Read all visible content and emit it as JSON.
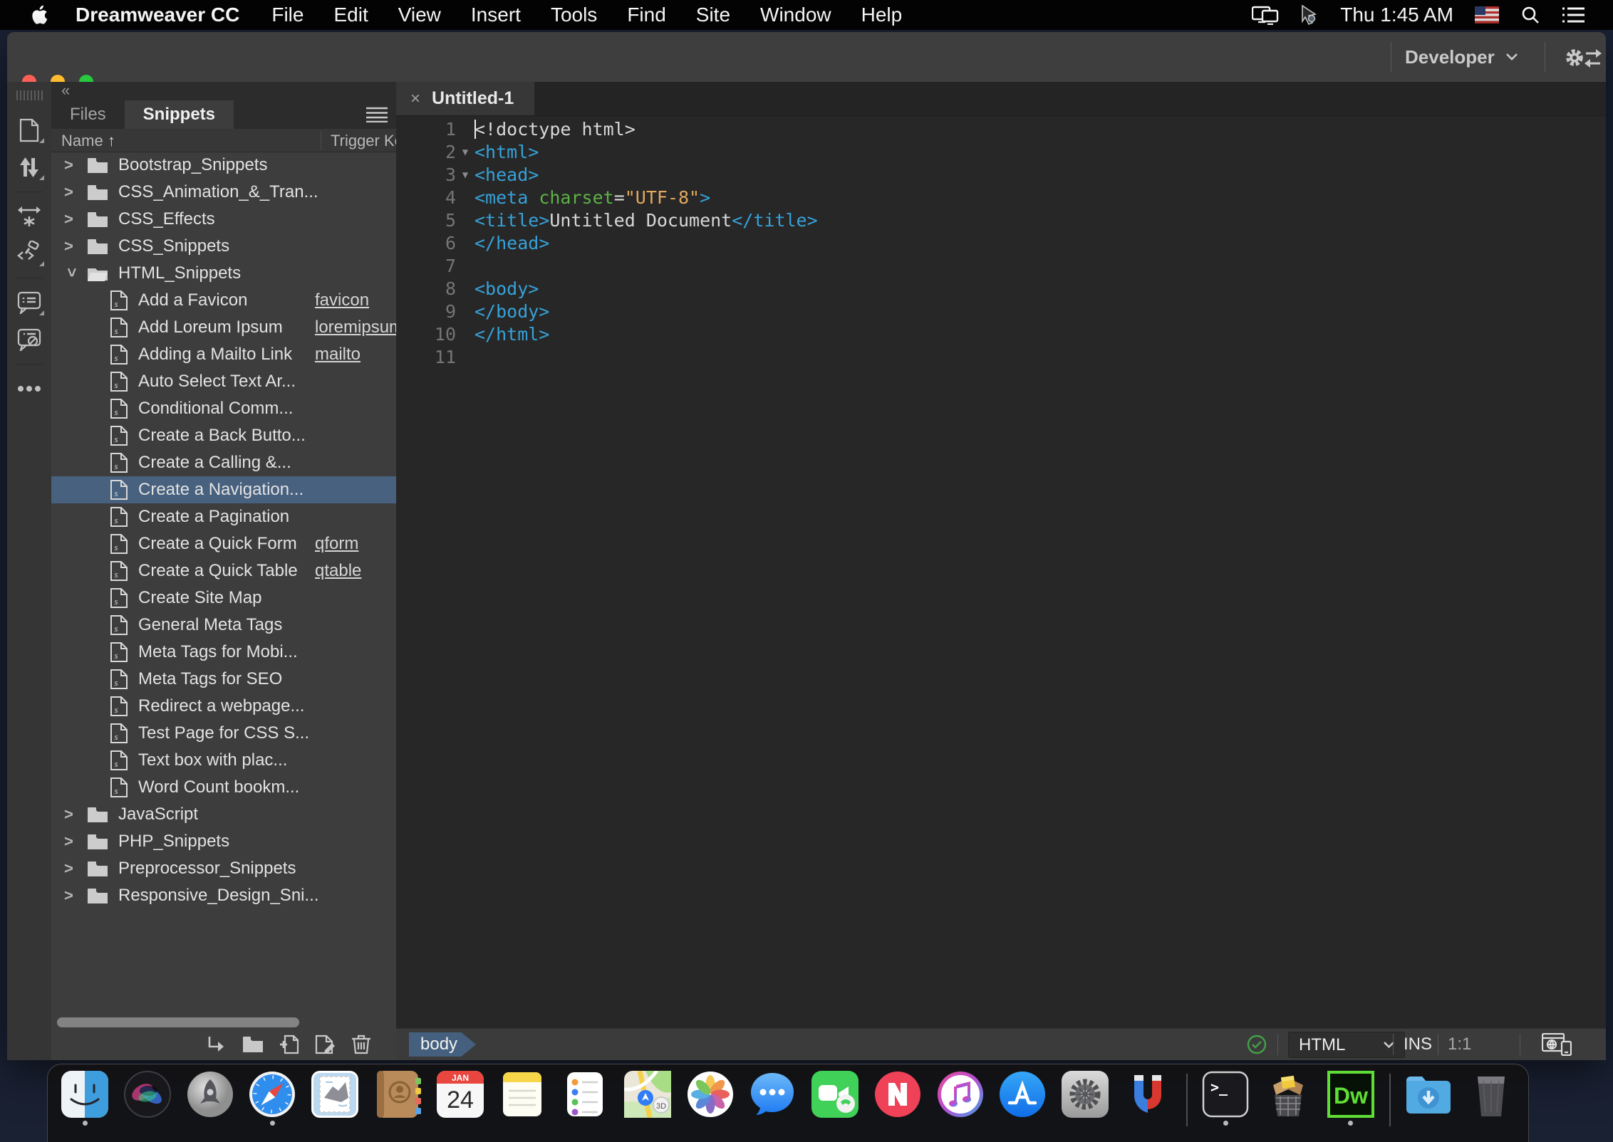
{
  "menu_bar": {
    "app_name": "Dreamweaver CC",
    "items": [
      "File",
      "Edit",
      "View",
      "Insert",
      "Tools",
      "Find",
      "Site",
      "Window",
      "Help"
    ],
    "clock": "Thu 1:45 AM"
  },
  "window": {
    "workspace": "Developer",
    "collapse_glyph": "«",
    "doc_tab": {
      "close_glyph": "×",
      "title": "Untitled-1"
    }
  },
  "panel": {
    "tabs": {
      "files": "Files",
      "snippets": "Snippets"
    },
    "active_tab": "Snippets",
    "columns": {
      "name": "Name",
      "sort_glyph": "↑",
      "trigger": "Trigger Keys"
    },
    "rows": [
      {
        "type": "folder",
        "label": "Bootstrap_Snippets"
      },
      {
        "type": "folder",
        "label": "CSS_Animation_&_Tran..."
      },
      {
        "type": "folder",
        "label": "CSS_Effects"
      },
      {
        "type": "folder",
        "label": "CSS_Snippets"
      },
      {
        "type": "folder",
        "label": "HTML_Snippets",
        "expanded": true
      },
      {
        "type": "snippet",
        "label": "Add a Favicon",
        "trigger": "favicon"
      },
      {
        "type": "snippet",
        "label": "Add Loreum Ipsum",
        "trigger": "loremipsum"
      },
      {
        "type": "snippet",
        "label": "Adding a Mailto Link",
        "trigger": "mailto"
      },
      {
        "type": "snippet",
        "label": "Auto Select Text Ar..."
      },
      {
        "type": "snippet",
        "label": "Conditional Comm..."
      },
      {
        "type": "snippet",
        "label": "Create a Back Butto..."
      },
      {
        "type": "snippet",
        "label": "Create a Calling &..."
      },
      {
        "type": "snippet",
        "label": "Create a Navigation...",
        "selected": true
      },
      {
        "type": "snippet",
        "label": "Create a Pagination"
      },
      {
        "type": "snippet",
        "label": "Create a Quick Form",
        "trigger": "qform"
      },
      {
        "type": "snippet",
        "label": "Create a Quick Table",
        "trigger": "qtable"
      },
      {
        "type": "snippet",
        "label": "Create Site Map"
      },
      {
        "type": "snippet",
        "label": "General Meta Tags"
      },
      {
        "type": "snippet",
        "label": "Meta Tags for Mobi..."
      },
      {
        "type": "snippet",
        "label": "Meta Tags for SEO"
      },
      {
        "type": "snippet",
        "label": "Redirect a webpage..."
      },
      {
        "type": "snippet",
        "label": "Test Page for CSS S..."
      },
      {
        "type": "snippet",
        "label": "Text box with plac..."
      },
      {
        "type": "snippet",
        "label": "Word Count bookm..."
      },
      {
        "type": "folder",
        "label": "JavaScript"
      },
      {
        "type": "folder",
        "label": "PHP_Snippets"
      },
      {
        "type": "folder",
        "label": "Preprocessor_Snippets"
      },
      {
        "type": "folder",
        "label": "Responsive_Design_Sni..."
      }
    ]
  },
  "editor": {
    "syntax_colors": {
      "tag": "#36a2d9",
      "attr_name": "#5db246",
      "attr_value": "#e2a85e",
      "plain": "#d8d8d8"
    },
    "lines": [
      {
        "n": "1",
        "caret": true,
        "segs": [
          {
            "c": "text",
            "t": "<!doctype html>"
          }
        ]
      },
      {
        "n": "2",
        "fold": true,
        "segs": [
          {
            "c": "tag",
            "t": "<html>"
          }
        ]
      },
      {
        "n": "3",
        "fold": true,
        "segs": [
          {
            "c": "tag",
            "t": "<head>"
          }
        ]
      },
      {
        "n": "4",
        "segs": [
          {
            "c": "tag",
            "t": "<meta"
          },
          {
            "c": "attr",
            "t": " charset"
          },
          {
            "c": "text",
            "t": "="
          },
          {
            "c": "value",
            "t": "\"UTF-8\""
          },
          {
            "c": "tag",
            "t": ">"
          }
        ]
      },
      {
        "n": "5",
        "segs": [
          {
            "c": "tag",
            "t": "<title>"
          },
          {
            "c": "text",
            "t": "Untitled Document"
          },
          {
            "c": "tag",
            "t": "</title>"
          }
        ]
      },
      {
        "n": "6",
        "segs": [
          {
            "c": "tag",
            "t": "</head>"
          }
        ]
      },
      {
        "n": "7",
        "segs": []
      },
      {
        "n": "8",
        "segs": [
          {
            "c": "tag",
            "t": "<body>"
          }
        ]
      },
      {
        "n": "9",
        "segs": [
          {
            "c": "tag",
            "t": "</body>"
          }
        ]
      },
      {
        "n": "10",
        "segs": [
          {
            "c": "tag",
            "t": "</html>"
          }
        ]
      },
      {
        "n": "11",
        "segs": []
      }
    ]
  },
  "status_bar": {
    "tag_selector": "body",
    "doc_type": "HTML",
    "insert_mode": "INS",
    "cursor_position": "1:1",
    "lint_ok_color": "#43a047"
  },
  "dock": {
    "calendar": {
      "month": "JAN",
      "day": "24"
    },
    "running": [
      "finder",
      "safari",
      "terminal",
      "dreamweaver"
    ],
    "items": [
      "finder",
      "siri",
      "launchpad",
      "safari",
      "mail",
      "contacts",
      "calendar",
      "notes",
      "reminders",
      "maps",
      "photos",
      "messages",
      "facetime",
      "news",
      "itunes",
      "app-store",
      "system-preferences",
      "magnet",
      "separator",
      "terminal",
      "installer",
      "dreamweaver",
      "separator",
      "downloads",
      "trash"
    ]
  }
}
